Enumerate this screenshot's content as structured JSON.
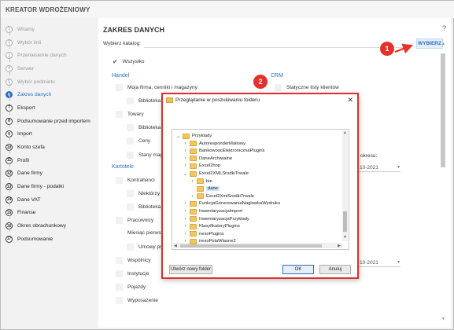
{
  "app": {
    "title": "KREATOR WDROŻENIOWY"
  },
  "steps": [
    {
      "n": "1",
      "label": "Witamy",
      "state": "done"
    },
    {
      "n": "2",
      "label": "Wybór linii",
      "state": "done"
    },
    {
      "n": "3",
      "label": "Przeniesienie danych",
      "state": "done"
    },
    {
      "n": "4",
      "label": "Serwer",
      "state": "done"
    },
    {
      "n": "5",
      "label": "Wybór podmiotu",
      "state": "done"
    },
    {
      "n": "6",
      "label": "Zakres danych",
      "state": "active"
    },
    {
      "n": "7",
      "label": "Eksport",
      "state": "todo"
    },
    {
      "n": "8",
      "label": "Podsumowanie przed importem",
      "state": "todo"
    },
    {
      "n": "9",
      "label": "Import",
      "state": "todo"
    },
    {
      "n": "10",
      "label": "Konto szefa",
      "state": "todo"
    },
    {
      "n": "11",
      "label": "Profil",
      "state": "todo"
    },
    {
      "n": "12",
      "label": "Dane firmy",
      "state": "todo"
    },
    {
      "n": "13",
      "label": "Dane firmy - podatki",
      "state": "todo"
    },
    {
      "n": "14",
      "label": "Dane VAT",
      "state": "todo"
    },
    {
      "n": "15",
      "label": "Finanse",
      "state": "todo"
    },
    {
      "n": "16",
      "label": "Okres obrachunkowy",
      "state": "todo"
    },
    {
      "n": "17",
      "label": "Podsumowanie",
      "state": "todo"
    }
  ],
  "main": {
    "title": "ZAKRES DANYCH",
    "help": "?",
    "catalog_label": "Wybierz katalog:",
    "catalog_value": "",
    "choose_button": "WYBIERZ",
    "check_all": "Wszystko",
    "handel": {
      "header": "Handel",
      "moja_firma": "Moja firma, cenniki i magazyny",
      "biblioteka1": "Biblioteka",
      "towary": "Towary",
      "biblioteka2": "Biblioteka",
      "ceny": "Ceny",
      "stany": "Stany mag"
    },
    "crm": {
      "header": "CRM",
      "statyczne": "Statyczne listy klientów"
    },
    "kartoteki": {
      "header": "Kartoteki",
      "kontrahenci": "Kontrahenci",
      "niektorzy": "Niektórzy",
      "biblioteka3": "Biblioteka",
      "pracownicy": "Pracownicy",
      "miesiac": "Miesiąc pierwsz",
      "umowy": "Umowy pr",
      "wspolnicy": "Wspólnicy",
      "instytucje": "Instytucje",
      "pojazdy": "Pojazdy",
      "wyposazenie": "Wyposażenie"
    },
    "okres_label": "okresu:",
    "date1": "10-2021",
    "date2": "10-2021"
  },
  "callouts": {
    "one": "1",
    "two": "2"
  },
  "dialog": {
    "title": "Przeglądanie w poszukiwaniu folderu",
    "close": "✕",
    "tree": [
      {
        "name": "Przyklady",
        "level": 0,
        "chev": "v"
      },
      {
        "name": "AutoresponderMailowy",
        "level": 1,
        "chev": ">"
      },
      {
        "name": "BankowoscElektronicznaPlugins",
        "level": 1,
        "chev": ">"
      },
      {
        "name": "DaneArchiwalne",
        "level": 1,
        "chev": ">"
      },
      {
        "name": "Excel2hop",
        "level": 1,
        "chev": ">"
      },
      {
        "name": "Excel2XMLSrodkiTrwale",
        "level": 1,
        "chev": "v"
      },
      {
        "name": "bin",
        "level": 2,
        "chev": ">"
      },
      {
        "name": "dane",
        "level": 2,
        "chev": "",
        "selected": true
      },
      {
        "name": "Excel2XmlSrodkiTrwale",
        "level": 2,
        "chev": ">"
      },
      {
        "name": "FunkcjaGenerowaniaNaglowkaWydruku",
        "level": 1,
        "chev": ">"
      },
      {
        "name": "InwentaryzacjaImport",
        "level": 1,
        "chev": ">"
      },
      {
        "name": "InwentaryzacjaPrzyklady",
        "level": 1,
        "chev": ">"
      },
      {
        "name": "KlasyfikatoryPlugins",
        "level": 1,
        "chev": ">"
      },
      {
        "name": "nexoPlugins",
        "level": 1,
        "chev": ">"
      },
      {
        "name": "nexoPolaWlasne2",
        "level": 1,
        "chev": ">"
      }
    ],
    "new_folder": "Utwórz nowy folder",
    "ok": "OK",
    "cancel": "Anuluj"
  },
  "colors": {
    "accent": "#2b6fc4",
    "callout": "#e4322b",
    "dialog_border": "#d9322a"
  }
}
